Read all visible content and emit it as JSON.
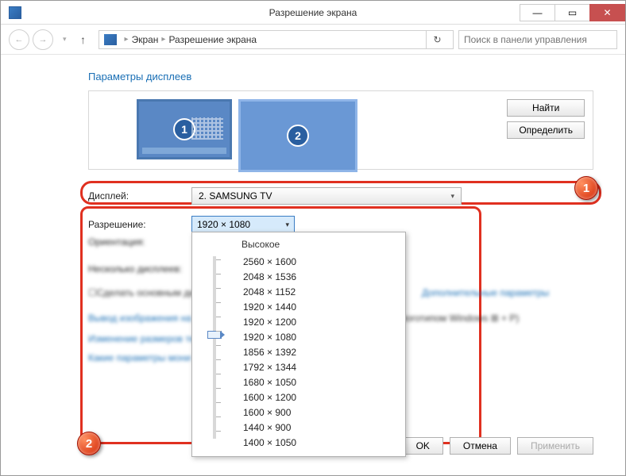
{
  "window": {
    "title": "Разрешение экрана"
  },
  "nav": {
    "crumb1": "Экран",
    "crumb2": "Разрешение экрана",
    "search_placeholder": "Поиск в панели управления"
  },
  "section": {
    "title": "Параметры дисплеев"
  },
  "monitors": {
    "m1": "1",
    "m2": "2"
  },
  "buttons": {
    "find": "Найти",
    "detect": "Определить",
    "ok": "OK",
    "cancel": "Отмена",
    "apply": "Применить"
  },
  "labels": {
    "display": "Дисплей:",
    "resolution": "Разрешение:",
    "orientation": "Ориентация:",
    "multi": "Несколько дисплеев:",
    "makemain": "Сделать основным дисплеем",
    "advanced": "Дополнительные параметры",
    "output": "Вывод изображения на",
    "winlogo": "(с логотипом Windows ⊞ + P)",
    "resize": "Изменение размеров те",
    "which": "Какие параметры мони"
  },
  "display_value": "2. SAMSUNG TV",
  "resolution_value": "1920 × 1080",
  "dropdown": {
    "title": "Высокое",
    "items": [
      "2560 × 1600",
      "2048 × 1536",
      "2048 × 1152",
      "1920 × 1440",
      "1920 × 1200",
      "1920 × 1080",
      "1856 × 1392",
      "1792 × 1344",
      "1680 × 1050",
      "1600 × 1200",
      "1600 × 900",
      "1440 × 900",
      "1400 × 1050"
    ]
  },
  "callouts": {
    "n1": "1",
    "n2": "2"
  }
}
